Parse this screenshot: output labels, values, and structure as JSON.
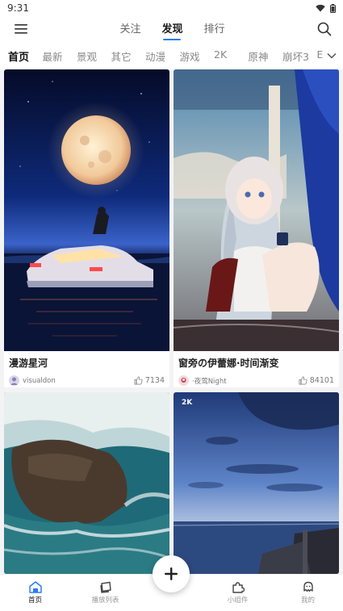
{
  "status": {
    "time": "9:31"
  },
  "top_tabs": [
    {
      "label": "关注"
    },
    {
      "label": "发现"
    },
    {
      "label": "排行"
    }
  ],
  "categories": [
    "首页",
    "最新",
    "景观",
    "其它",
    "动漫",
    "游戏",
    "2K",
    "原神",
    "崩坏3",
    "E"
  ],
  "cards": [
    {
      "title": "漫游星河",
      "author": "visualdon",
      "likes": "7134"
    },
    {
      "title": "窗旁の伊蕾娜·时间渐变",
      "author": "·夜莺Night",
      "likes": "84101"
    },
    {
      "badge": ""
    },
    {
      "badge": "2K"
    }
  ],
  "tabbar": {
    "home": "首页",
    "playlist": "播放列表",
    "widgets": "小组件",
    "mine": "我的"
  },
  "colors": {
    "accent": "#2a7cf0",
    "home_icon": "#2a7cf0"
  }
}
